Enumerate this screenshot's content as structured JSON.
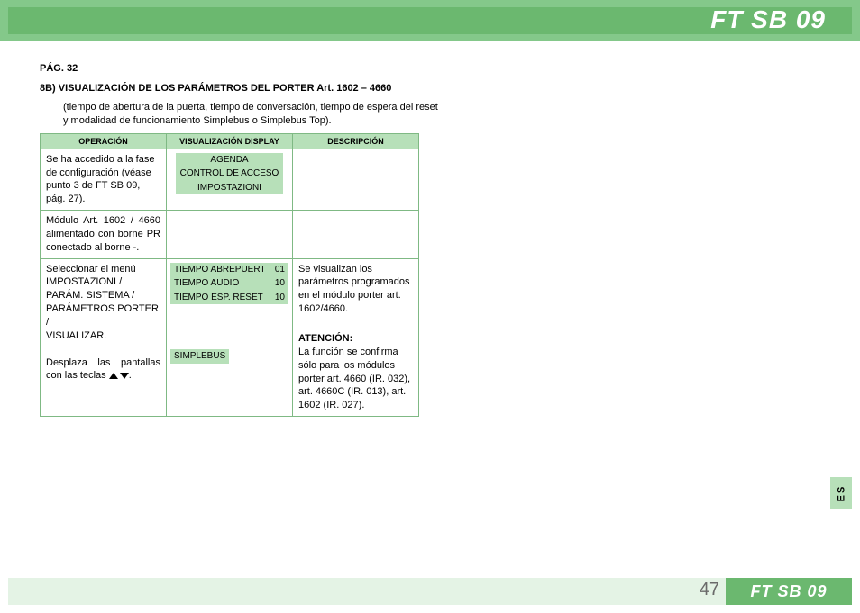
{
  "header": {
    "title": "FT SB 09"
  },
  "page_label": "PÁG. 32",
  "section_title": "8B) VISUALIZACIÓN DE LOS PARÁMETROS DEL PORTER Art. 1602 – 4660",
  "intro": "(tiempo de abertura de la puerta, tiempo de conversación, tiempo de espera del reset y modalidad de funcionamiento Simplebus o Simplebus Top).",
  "table": {
    "headers": [
      "OPERACIÓN",
      "VISUALIZACIÓN DISPLAY",
      "DESCRIPCIÓN"
    ],
    "rows": [
      {
        "op": "Se ha accedido a la fase de configuración (véase punto 3 de FT SB 09, pág. 27).",
        "display": {
          "lines": [
            "AGENDA",
            "CONTROL DE ACCESO",
            "IMPOSTAZIONI"
          ]
        },
        "desc": ""
      },
      {
        "op": "Módulo Art. 1602 / 4660 alimentado con borne PR conectado al borne -.",
        "display": null,
        "desc": ""
      },
      {
        "op_lines": [
          "Seleccionar el menú",
          "IMPOSTAZIONI /",
          "PARÁM. SISTEMA /",
          "PARÁMETROS PORTER /",
          "VISUALIZAR."
        ],
        "op_tail_pre": "Desplaza las pantallas con las teclas ",
        "op_tail_post": ".",
        "display": {
          "rows": [
            {
              "label": "TIEMPO ABREPUERT",
              "val": "01"
            },
            {
              "label": "TIEMPO AUDIO",
              "val": "10"
            },
            {
              "label": "TIEMPO ESP. RESET",
              "val": "10"
            }
          ],
          "simple": "SIMPLEBUS"
        },
        "desc_main": "Se visualizan los parámetros programados en el módulo porter art. 1602/4660.",
        "atn_label": "ATENCIÓN",
        "desc_atn": "La función se confirma sólo para los módulos porter art. 4660 (IR. 032), art. 4660C (IR. 013), art. 1602 (IR. 027)."
      }
    ]
  },
  "side_tab": "ES",
  "footer": {
    "page_number": "47",
    "code": "FT SB 09"
  }
}
